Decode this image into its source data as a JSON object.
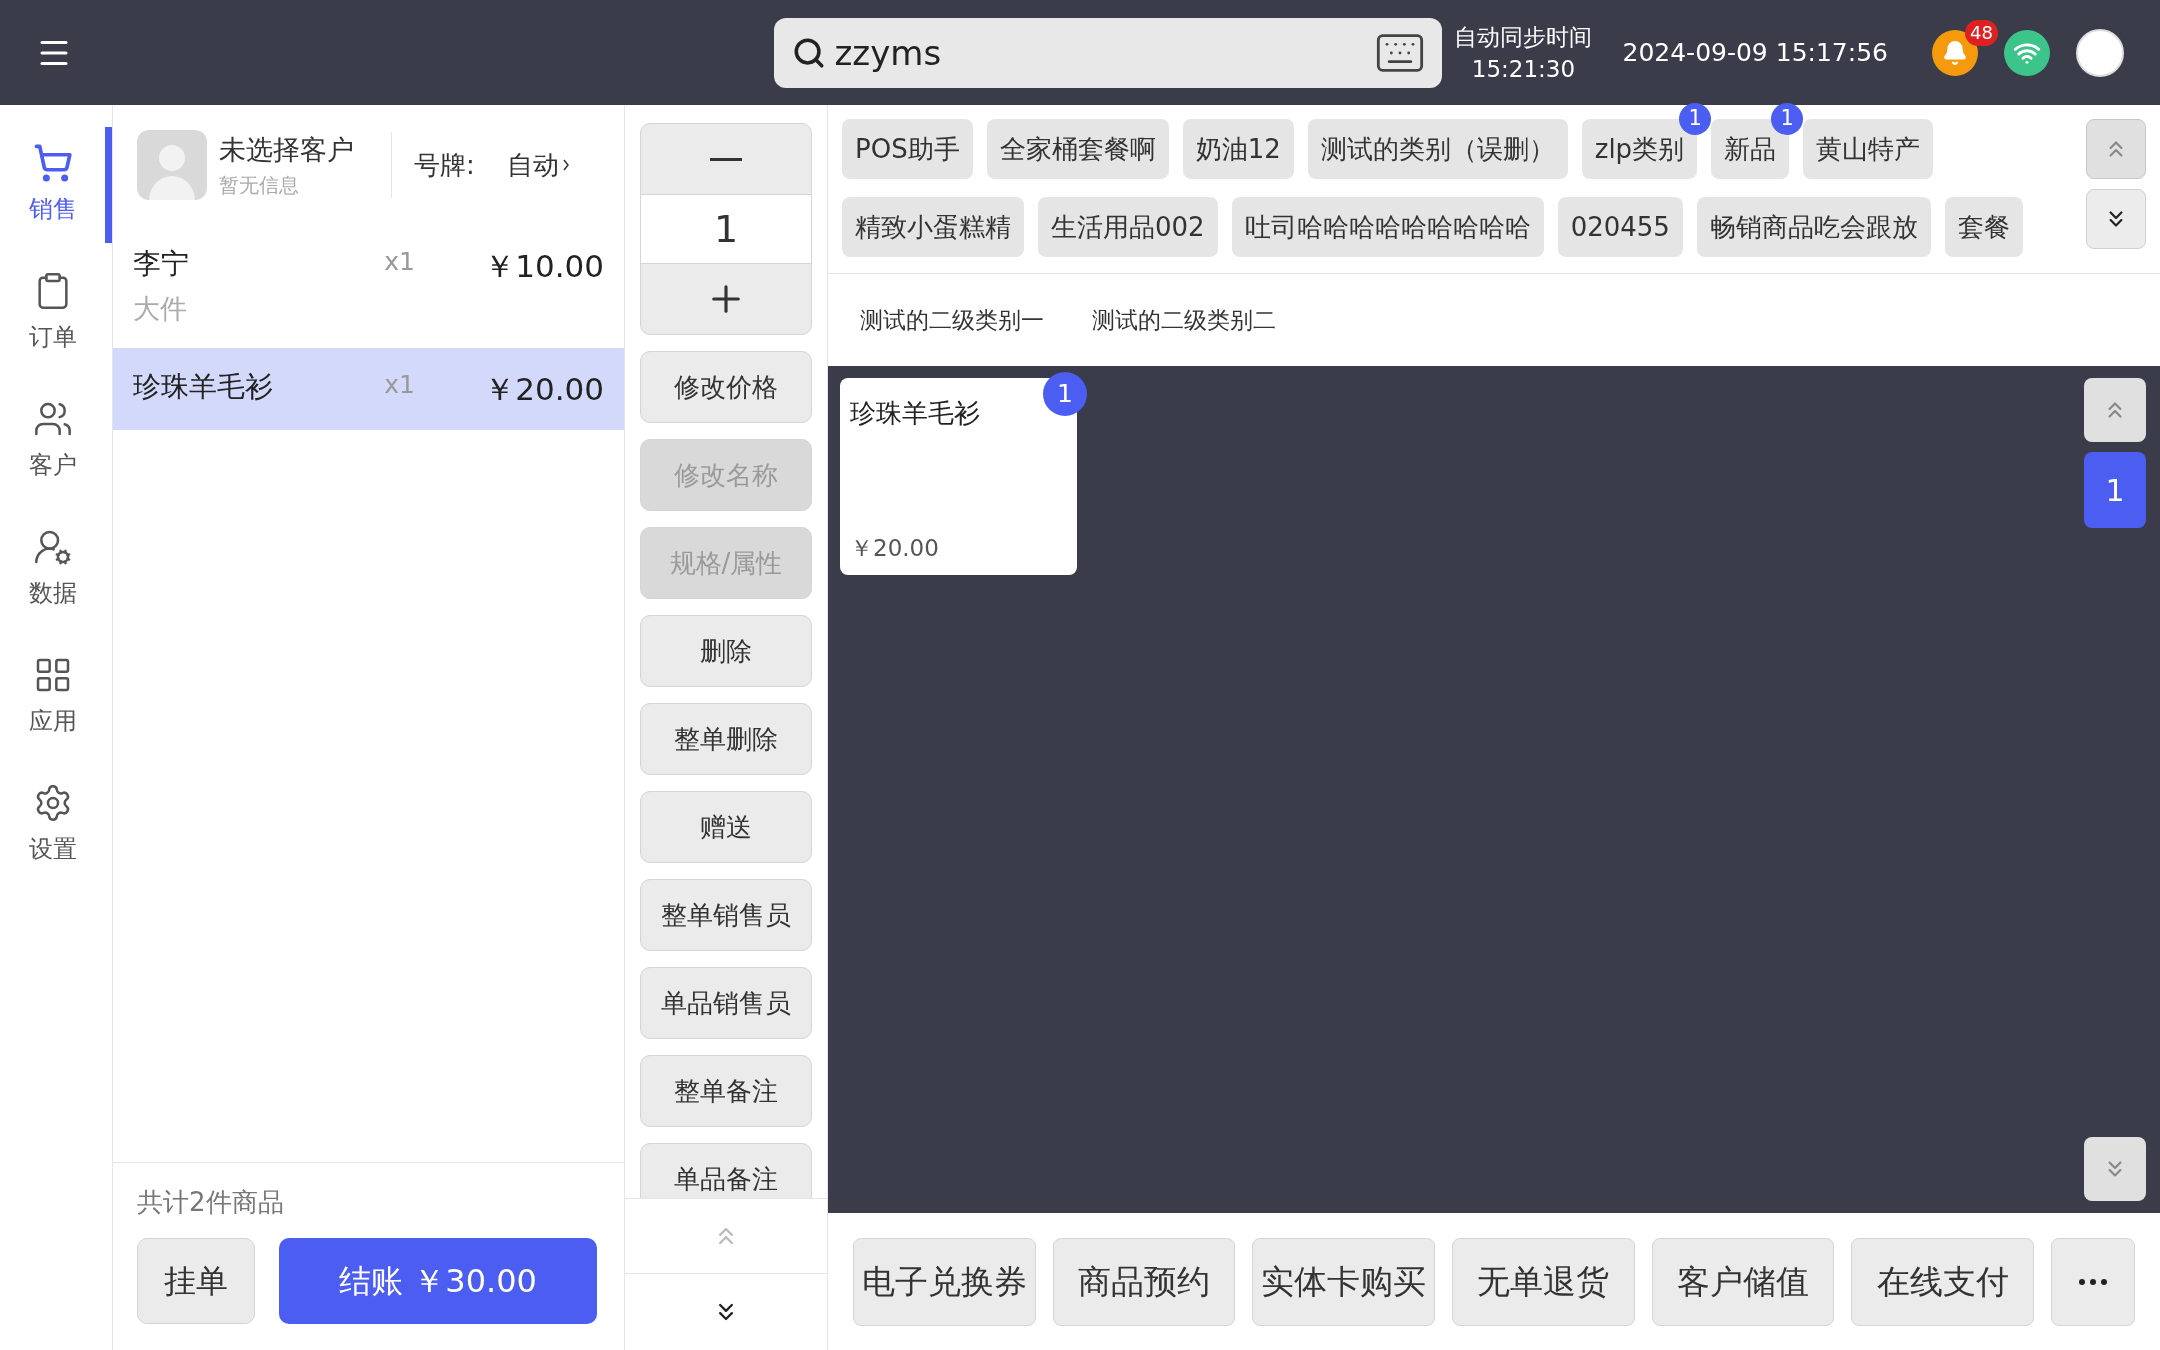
{
  "nav": {
    "items": [
      {
        "label": "销售",
        "selected": true
      },
      {
        "label": "订单",
        "selected": false
      },
      {
        "label": "客户",
        "selected": false
      },
      {
        "label": "数据",
        "selected": false
      },
      {
        "label": "应用",
        "selected": false
      },
      {
        "label": "设置",
        "selected": false
      }
    ]
  },
  "search": {
    "value": "zzyms"
  },
  "sync": {
    "label": "自动同步时间",
    "time": "15:21:30"
  },
  "datetime": "2024-09-09 15:17:56",
  "notifications": {
    "count": "48"
  },
  "customer": {
    "name": "未选择客户",
    "info": "暂无信息",
    "number_label": "号牌:",
    "number_value": "自动"
  },
  "order_items": [
    {
      "name": "李宁",
      "note": "大件",
      "qty": "x1",
      "price": "￥10.00",
      "selected": false
    },
    {
      "name": "珍珠羊毛衫",
      "qty": "x1",
      "price": "￥20.00",
      "selected": true
    }
  ],
  "order_summary": {
    "count": "共计2件商品",
    "hold": "挂单",
    "checkout": "结账 ￥30.00"
  },
  "quantity": {
    "value": "1"
  },
  "actions": [
    {
      "label": "修改价格",
      "disabled": false
    },
    {
      "label": "修改名称",
      "disabled": true
    },
    {
      "label": "规格/属性",
      "disabled": true
    },
    {
      "label": "删除",
      "disabled": false
    },
    {
      "label": "整单删除",
      "disabled": false
    },
    {
      "label": "赠送",
      "disabled": false
    },
    {
      "label": "整单销售员",
      "disabled": false
    },
    {
      "label": "单品销售员",
      "disabled": false
    },
    {
      "label": "整单备注",
      "disabled": false
    },
    {
      "label": "单品备注",
      "disabled": false
    }
  ],
  "categories": [
    [
      {
        "label": "POS助手"
      },
      {
        "label": "全家桶套餐啊"
      },
      {
        "label": "奶油12"
      },
      {
        "label": "测试的类别（误删）"
      },
      {
        "label": "zlp类别",
        "badge": "1"
      },
      {
        "label": "新品",
        "badge": "1"
      },
      {
        "label": "黄山特产"
      }
    ],
    [
      {
        "label": "精致小蛋糕精"
      },
      {
        "label": "生活用品002"
      },
      {
        "label": "吐司哈哈哈哈哈哈哈哈哈"
      },
      {
        "label": "020455"
      },
      {
        "label": "畅销商品吃会跟放"
      },
      {
        "label": "套餐"
      }
    ]
  ],
  "subcategories": [
    {
      "label": "测试的二级类别一"
    },
    {
      "label": "测试的二级类别二"
    }
  ],
  "products": [
    {
      "name": "珍珠羊毛衫",
      "price": "￥20.00",
      "badge": "1"
    }
  ],
  "page": "1",
  "bottom_buttons": [
    "电子兑换券",
    "商品预约",
    "实体卡购买",
    "无单退货",
    "客户储值",
    "在线支付"
  ]
}
